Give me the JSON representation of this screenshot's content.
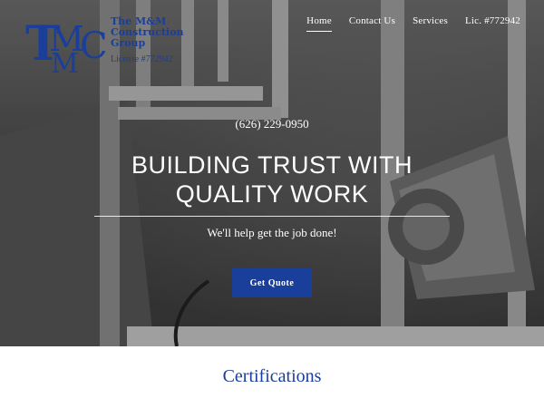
{
  "brand": {
    "monogram": "TMMC",
    "name": "The M&M Construction Group",
    "license": "License #772942",
    "color": "#1a3f9a"
  },
  "nav": {
    "items": [
      {
        "label": "Home",
        "active": true
      },
      {
        "label": "Contact Us"
      },
      {
        "label": "Services"
      },
      {
        "label": "Lic. #772942"
      }
    ]
  },
  "hero": {
    "phone": "(626) 229-0950",
    "headline_line1": "BUILDING TRUST WITH",
    "headline_line2": "QUALITY WORK",
    "subline": "We'll help get the job done!",
    "cta_label": "Get Quote"
  },
  "section": {
    "title": "Certifications"
  }
}
